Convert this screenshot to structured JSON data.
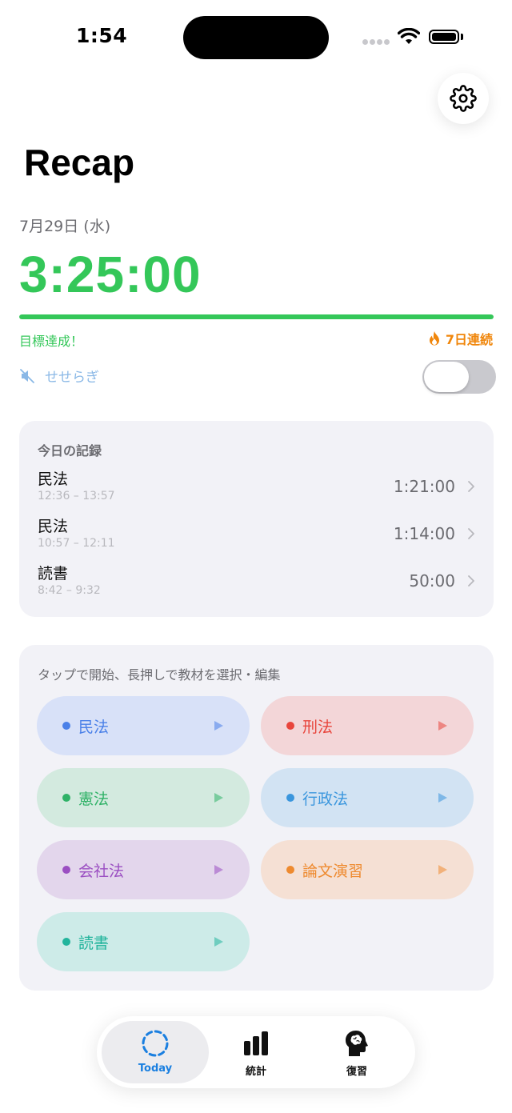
{
  "status_bar": {
    "time": "1:54"
  },
  "app": {
    "title": "Recap"
  },
  "today": {
    "date": "7月29日 (水)",
    "elapsed": "3:25:00",
    "goal_progress": 1.0,
    "goal_status": "目標達成！",
    "streak": "7日連続"
  },
  "ambient": {
    "sound_name": "せせらぎ",
    "enabled": false
  },
  "records": {
    "header": "今日の記録",
    "items": [
      {
        "subject": "民法",
        "range": "12:36 – 13:57",
        "duration": "1:21:00"
      },
      {
        "subject": "民法",
        "range": "10:57 – 12:11",
        "duration": "1:14:00"
      },
      {
        "subject": "読書",
        "range": "8:42 – 9:32",
        "duration": "50:00"
      }
    ]
  },
  "subjects": {
    "hint": "タップで開始、長押しで教材を選択・編集",
    "items": [
      {
        "label": "民法",
        "color": "#4a80e8",
        "bg": "#d8e1f8"
      },
      {
        "label": "刑法",
        "color": "#e8453c",
        "bg": "#f3d6d8"
      },
      {
        "label": "憲法",
        "color": "#2fb267",
        "bg": "#d3eadf"
      },
      {
        "label": "行政法",
        "color": "#3a96dd",
        "bg": "#d2e3f3"
      },
      {
        "label": "会社法",
        "color": "#9b4fc2",
        "bg": "#e3d6ec"
      },
      {
        "label": "論文演習",
        "color": "#ee8a2f",
        "bg": "#f5e0d4"
      },
      {
        "label": "読書",
        "color": "#22b49c",
        "bg": "#cdebe8"
      }
    ]
  },
  "tabs": [
    {
      "label": "Today",
      "active": true,
      "icon": "dashed-circle-icon"
    },
    {
      "label": "統計",
      "active": false,
      "icon": "bar-chart-icon"
    },
    {
      "label": "復習",
      "active": false,
      "icon": "brain-head-icon"
    }
  ],
  "colors": {
    "accent_green": "#34c759",
    "streak_orange": "#f0860b",
    "tab_blue": "#1a7fe0"
  }
}
